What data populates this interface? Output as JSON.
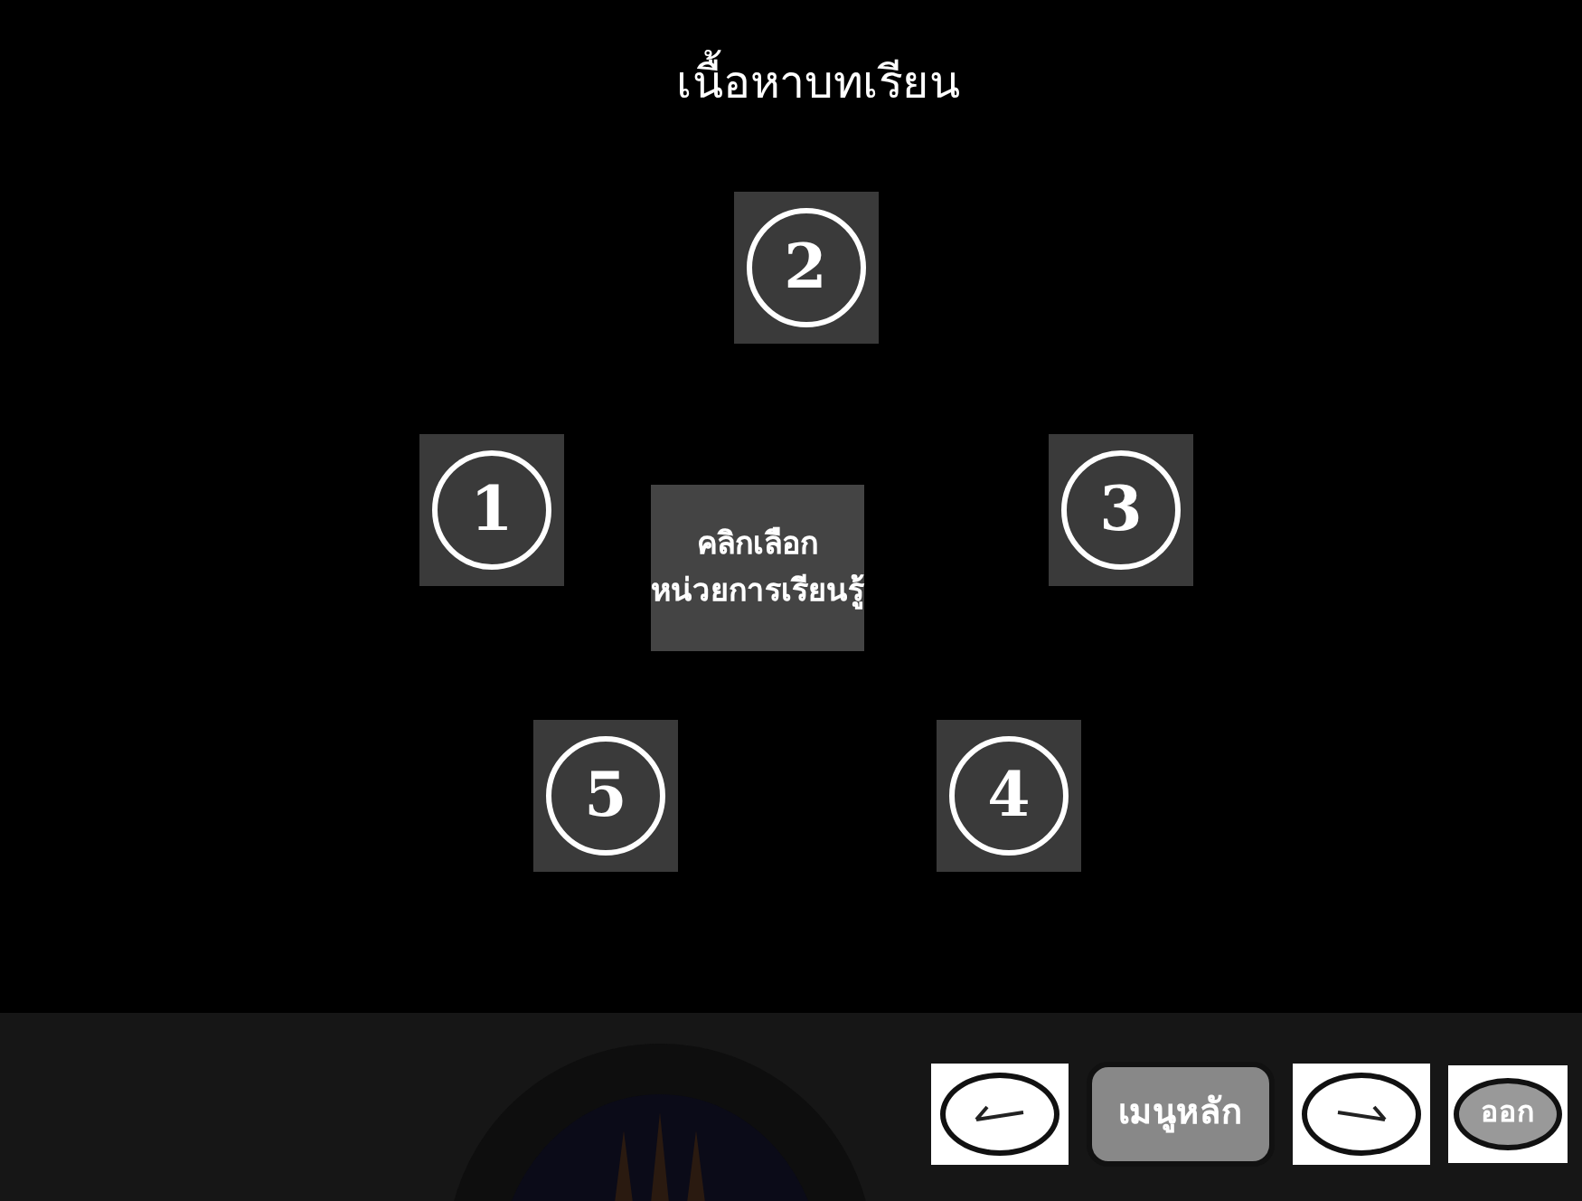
{
  "title": "เนื้อหาบทเรียน",
  "units": [
    {
      "label": "2"
    },
    {
      "label": "1"
    },
    {
      "label": "3"
    },
    {
      "label": "5"
    },
    {
      "label": "4"
    }
  ],
  "prompt": [
    "คลิกเลือก",
    "หน่วยการเรียนรู้"
  ],
  "nav": [
    {
      "kind": "back"
    },
    {
      "kind": "main",
      "label": "เมนูหลัก"
    },
    {
      "kind": "forward"
    },
    {
      "kind": "exit",
      "label": "ออก"
    }
  ]
}
